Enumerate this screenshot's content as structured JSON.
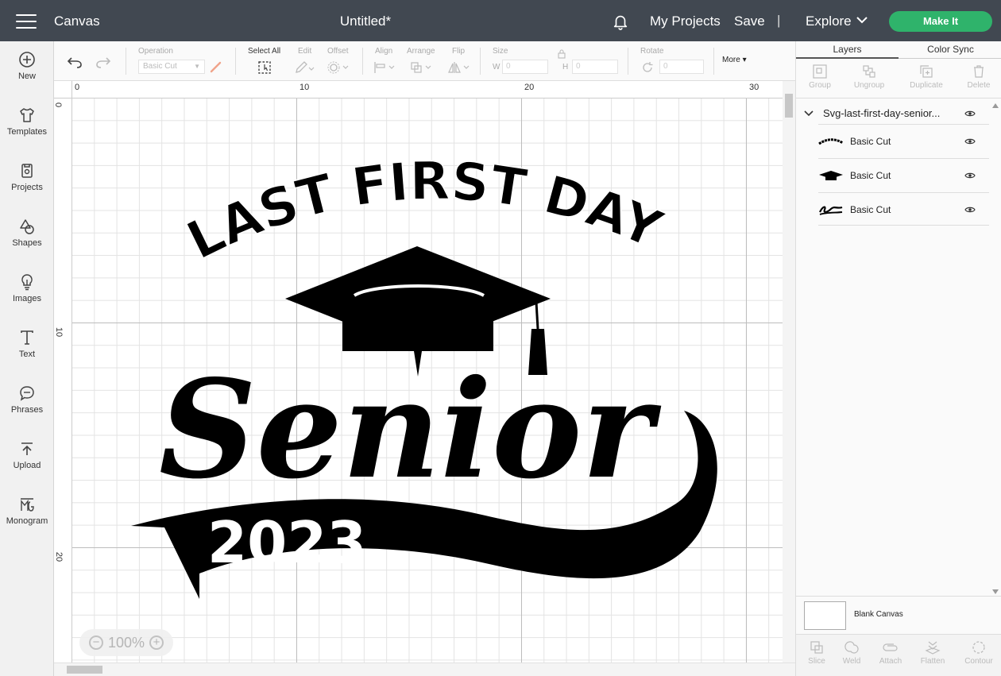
{
  "topbar": {
    "app_title": "Canvas",
    "doc_title": "Untitled*",
    "my_projects": "My Projects",
    "save": "Save",
    "separator": "|",
    "explore": "Explore",
    "make_it": "Make It"
  },
  "sidebar": {
    "items": [
      {
        "label": "New",
        "icon": "plus-circle-icon"
      },
      {
        "label": "Templates",
        "icon": "shirt-icon"
      },
      {
        "label": "Projects",
        "icon": "projects-icon"
      },
      {
        "label": "Shapes",
        "icon": "shapes-icon"
      },
      {
        "label": "Images",
        "icon": "lightbulb-icon"
      },
      {
        "label": "Text",
        "icon": "text-icon"
      },
      {
        "label": "Phrases",
        "icon": "speech-bubble-icon"
      },
      {
        "label": "Upload",
        "icon": "upload-icon"
      },
      {
        "label": "Monogram",
        "icon": "monogram-icon"
      }
    ]
  },
  "toolbar": {
    "operation_label": "Operation",
    "operation_value": "Basic Cut",
    "select_all": "Select All",
    "edit": "Edit",
    "offset": "Offset",
    "align": "Align",
    "arrange": "Arrange",
    "flip": "Flip",
    "size": "Size",
    "w_label": "W",
    "w_value": "0",
    "h_label": "H",
    "h_value": "0",
    "rotate": "Rotate",
    "rotate_value": "0",
    "more": "More"
  },
  "rulers": {
    "top": [
      "0",
      "10",
      "20",
      "30"
    ],
    "left": [
      "0",
      "10",
      "20"
    ]
  },
  "zoom": {
    "minus": "−",
    "value": "100%",
    "plus": "+"
  },
  "design": {
    "arc_text": "LAST FIRST DAY",
    "script_word": "Senior",
    "year": "2023"
  },
  "panel": {
    "tabs": [
      "Layers",
      "Color Sync"
    ],
    "tools": [
      "Group",
      "Ungroup",
      "Duplicate",
      "Delete"
    ],
    "group_name": "Svg-last-first-day-senior...",
    "layers": [
      {
        "name": "Basic Cut",
        "thumb": "arc-text-thumbnail"
      },
      {
        "name": "Basic Cut",
        "thumb": "grad-cap-thumbnail"
      },
      {
        "name": "Basic Cut",
        "thumb": "senior-script-thumbnail"
      }
    ],
    "blank_canvas": "Blank Canvas",
    "bottom_tools": [
      "Slice",
      "Weld",
      "Attach",
      "Flatten",
      "Contour"
    ]
  },
  "colors": {
    "topbar": "#414851",
    "make_it": "#2fb36b",
    "design_fill": "#000000"
  }
}
